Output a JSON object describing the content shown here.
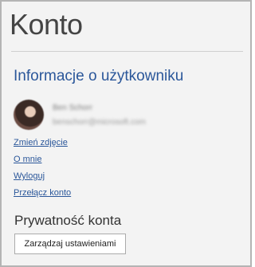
{
  "page": {
    "title": "Konto"
  },
  "user_info": {
    "heading": "Informacje o użytkowniku",
    "name": "Ben Schorr",
    "email": "benschorr@microsoft.com",
    "links": [
      "Zmień zdjęcie",
      "O mnie",
      "Wyloguj",
      "Przełącz konto"
    ]
  },
  "privacy": {
    "heading": "Prywatność konta",
    "button_label": "Zarządzaj ustawieniami"
  }
}
